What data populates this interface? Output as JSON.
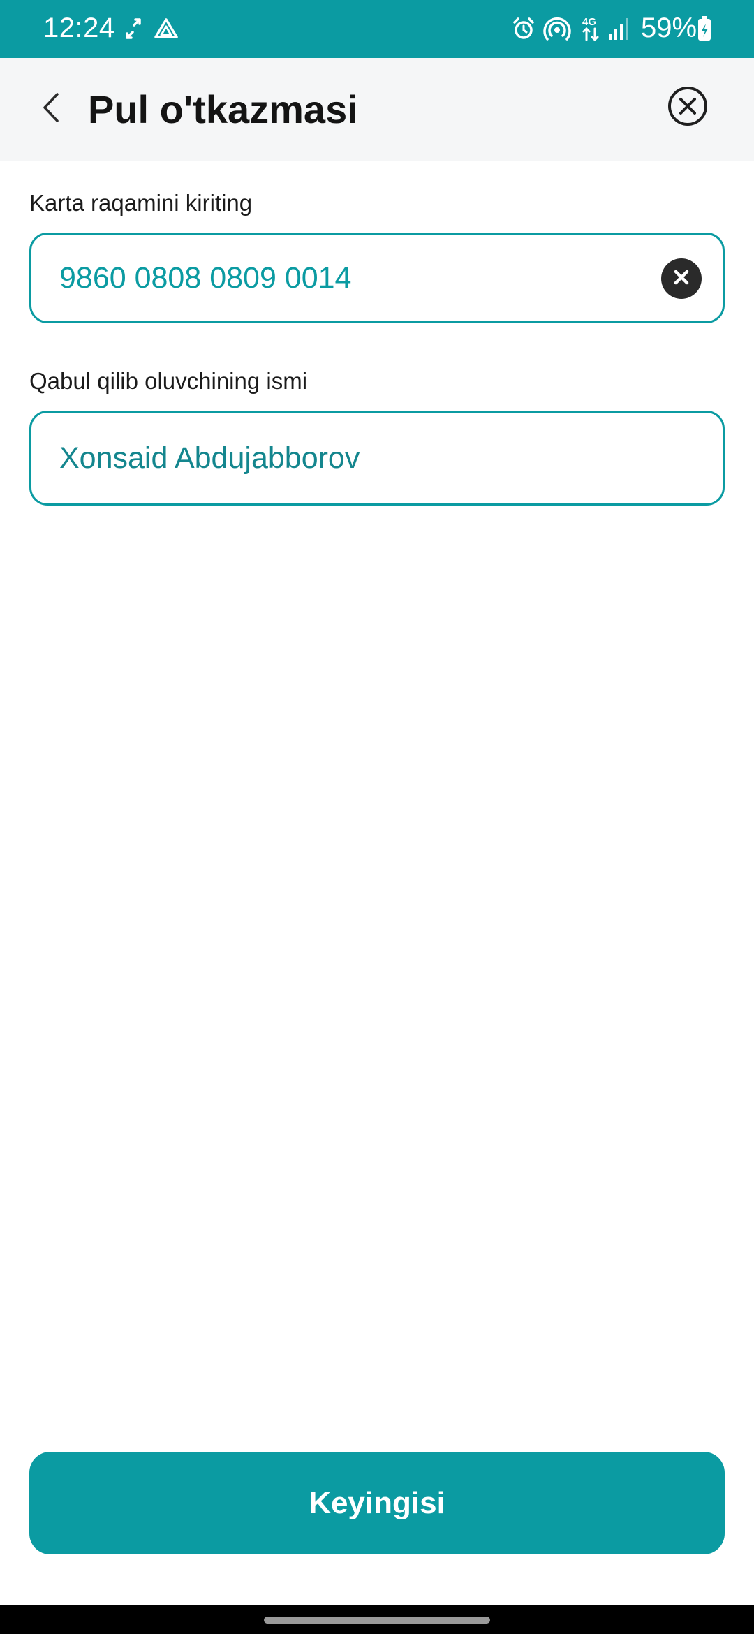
{
  "status_bar": {
    "time": "12:24",
    "battery_percent": "59%",
    "network_label": "4G",
    "icons": [
      "sync-arrows-icon",
      "drive-icon",
      "alarm-icon",
      "hotspot-icon",
      "network-4g-icon",
      "signal-icon",
      "battery-charging-icon"
    ],
    "background_color": "#0b9ba2"
  },
  "header": {
    "title": "Pul o'tkazmasi",
    "back_icon": "chevron-left-icon",
    "close_icon": "close-circle-icon"
  },
  "form": {
    "card_number": {
      "label": "Karta raqamini kiriting",
      "value": "9860 0808 0809 0014",
      "clear_icon": "clear-icon"
    },
    "recipient_name": {
      "label": "Qabul qilib oluvchining ismi",
      "value": "Xonsaid Abdujabborov"
    }
  },
  "actions": {
    "next_label": "Keyingisi"
  },
  "colors": {
    "accent": "#0b9ba2",
    "header_bg": "#f5f6f7",
    "text_dark": "#141414"
  }
}
